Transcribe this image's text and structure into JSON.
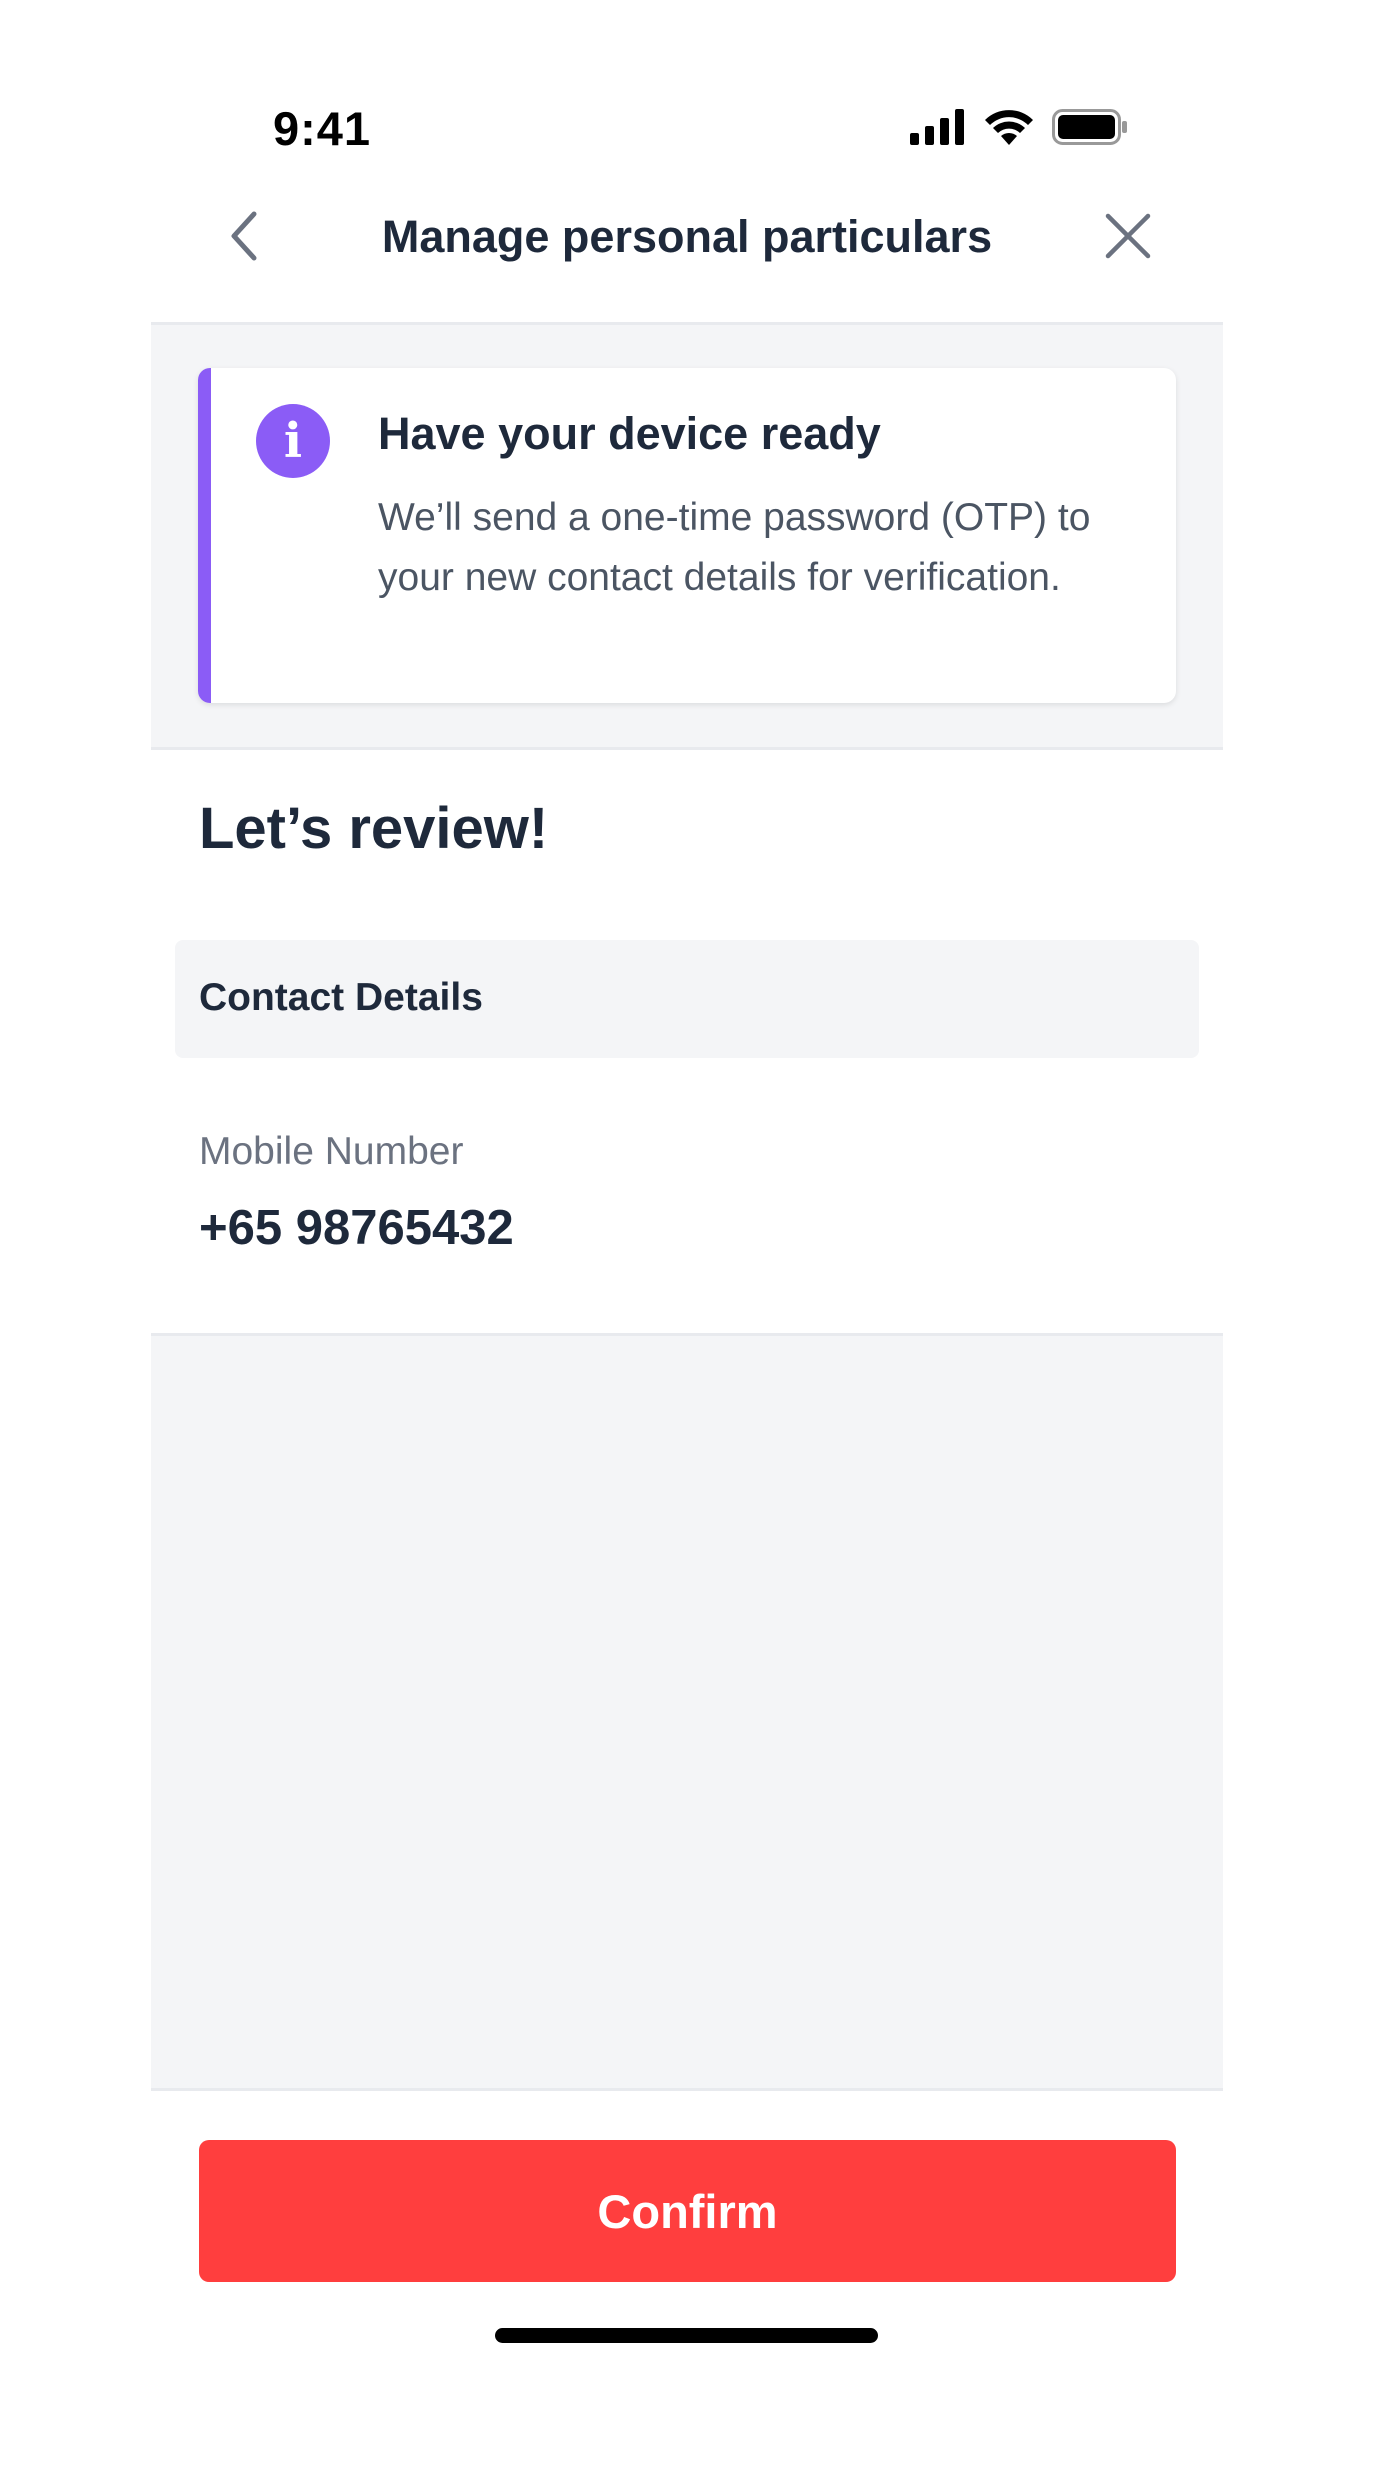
{
  "status_bar": {
    "time": "9:41",
    "icons": [
      "signal-icon",
      "wifi-icon",
      "battery-icon"
    ]
  },
  "header": {
    "title": "Manage personal particulars",
    "back_icon": "chevron-left-icon",
    "close_icon": "close-icon"
  },
  "info_banner": {
    "icon": "info-icon",
    "icon_glyph": "i",
    "title": "Have your device ready",
    "body": "We’ll send a one-time password (OTP) to your new contact details for verification.",
    "accent_color": "#8b5cf6"
  },
  "review": {
    "title": "Let’s review!",
    "section_label": "Contact Details",
    "fields": [
      {
        "label": "Mobile Number",
        "value": "+65 98765432"
      }
    ]
  },
  "footer": {
    "confirm_label": "Confirm",
    "confirm_color": "#ff3e3e"
  }
}
